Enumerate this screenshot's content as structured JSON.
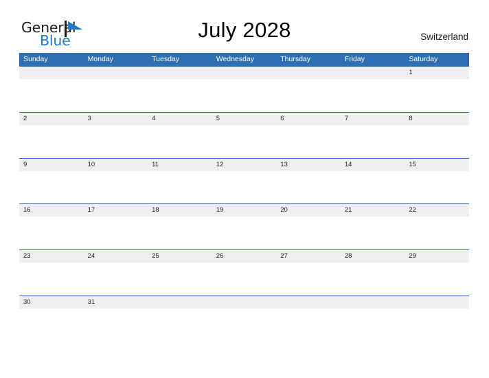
{
  "header": {
    "logo": {
      "word_one": "General",
      "word_two": "Blue",
      "mark_icon": "blue-sail-triangle-icon",
      "mark_color": "#1f7bc1"
    },
    "title": "July 2028",
    "country": "Switzerland"
  },
  "calendar": {
    "month": "July",
    "year": "2028",
    "accent_color": "#2e70b3",
    "band_color": "#efefef",
    "weekday_headers": [
      "Sunday",
      "Monday",
      "Tuesday",
      "Wednesday",
      "Thursday",
      "Friday",
      "Saturday"
    ],
    "weeks": [
      {
        "days": [
          "",
          "",
          "",
          "",
          "",
          "",
          "1"
        ]
      },
      {
        "days": [
          "2",
          "3",
          "4",
          "5",
          "6",
          "7",
          "8"
        ]
      },
      {
        "days": [
          "9",
          "10",
          "11",
          "12",
          "13",
          "14",
          "15"
        ]
      },
      {
        "days": [
          "16",
          "17",
          "18",
          "19",
          "20",
          "21",
          "22"
        ]
      },
      {
        "days": [
          "23",
          "24",
          "25",
          "26",
          "27",
          "28",
          "29"
        ]
      },
      {
        "days": [
          "30",
          "31",
          "",
          "",
          "",
          "",
          ""
        ]
      }
    ]
  }
}
